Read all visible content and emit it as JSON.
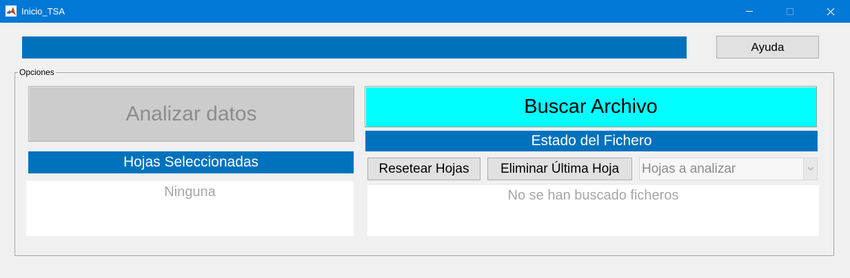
{
  "window": {
    "title": "Inicio_TSA",
    "icon": "matlab-icon",
    "controls": [
      "minimize-icon",
      "maximize-icon",
      "close-icon"
    ]
  },
  "progress": {
    "value": 1.0,
    "color": "#0072bd"
  },
  "help_button": {
    "label": "Ayuda"
  },
  "options_panel": {
    "title": "Opciones",
    "analyze_button": {
      "label": "Analizar datos",
      "enabled": false
    },
    "browse_button": {
      "label": "Buscar Archivo",
      "color": "#00ffff"
    },
    "file_status": {
      "header": "Estado del Fichero",
      "message": "No se han buscado ficheros"
    },
    "selected_sheets": {
      "header": "Hojas Seleccionadas",
      "value": "Ninguna"
    },
    "reset_button": {
      "label": "Resetear Hojas"
    },
    "delete_last_button": {
      "label": "Eliminar Última Hoja"
    },
    "sheet_selector": {
      "value": "Hojas a analizar",
      "enabled": false
    }
  },
  "colors": {
    "title_bar": "#0078d7",
    "accent_blue": "#0072bd",
    "background": "#f0f0f0"
  }
}
